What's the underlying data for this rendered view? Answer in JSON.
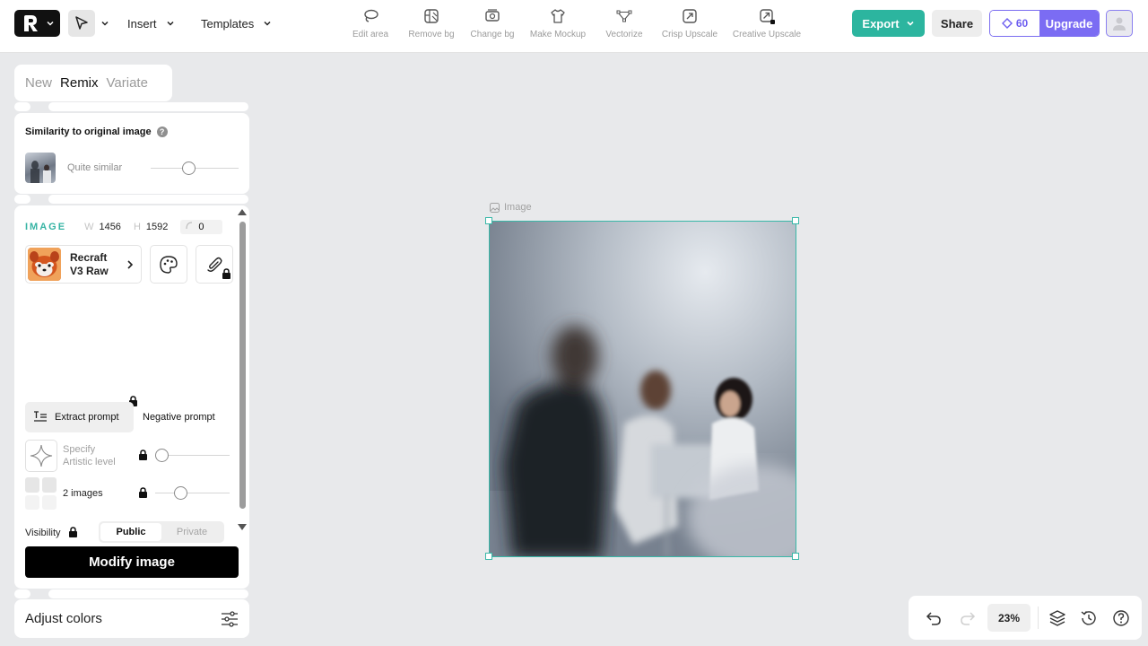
{
  "topbar": {
    "insert_label": "Insert",
    "templates_label": "Templates",
    "actions": [
      {
        "label": "Edit area",
        "icon": "lasso-icon"
      },
      {
        "label": "Remove bg",
        "icon": "remove-bg-icon"
      },
      {
        "label": "Change bg",
        "icon": "change-bg-icon"
      },
      {
        "label": "Make Mockup",
        "icon": "tshirt-icon"
      },
      {
        "label": "Vectorize",
        "icon": "vector-nodes-icon"
      },
      {
        "label": "Crisp Upscale",
        "icon": "crisp-upscale-icon"
      },
      {
        "label": "Creative Upscale",
        "icon": "creative-upscale-icon"
      }
    ],
    "export_label": "Export",
    "share_label": "Share",
    "credits": "60",
    "upgrade_label": "Upgrade"
  },
  "mode_tabs": [
    {
      "label": "New",
      "active": false
    },
    {
      "label": "Remix",
      "active": true
    },
    {
      "label": "Variate",
      "active": false
    }
  ],
  "similarity": {
    "title": "Similarity to original image",
    "help": "?",
    "level_label": "Quite similar",
    "value": 0.45
  },
  "image_panel": {
    "title": "IMAGE",
    "width_key": "W",
    "width": "1456",
    "height_key": "H",
    "height": "1592",
    "radius": "0",
    "model_line1": "Recraft",
    "model_line2": "V3 Raw",
    "extract_label": "Extract prompt",
    "negative_label": "Negative prompt",
    "artistic_line1": "Specify",
    "artistic_line2": "Artistic level",
    "artistic_value": 0.0,
    "images_label": "2 images",
    "images_value": 0.35,
    "visibility_label": "Visibility",
    "visibility_options": [
      "Public",
      "Private"
    ],
    "visibility_selected": "Public",
    "modify_label": "Modify image"
  },
  "adjust_label": "Adjust colors",
  "canvas": {
    "frame_label": "Image"
  },
  "bottom_bar": {
    "zoom": "23%"
  },
  "colors": {
    "accent_teal": "#2cb59f",
    "accent_purple": "#7b6cf3",
    "selection": "#39b8a8"
  }
}
